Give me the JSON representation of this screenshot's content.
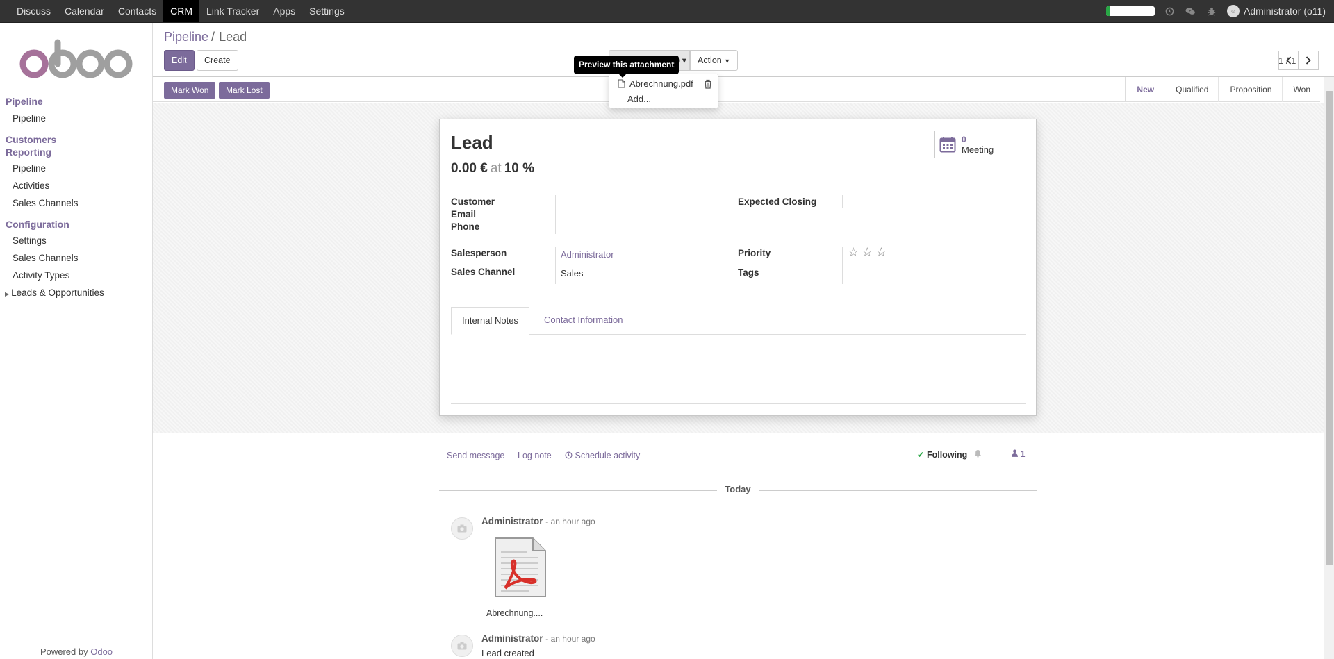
{
  "topbar": {
    "menu": [
      "Discuss",
      "Calendar",
      "Contacts",
      "CRM",
      "Link Tracker",
      "Apps",
      "Settings"
    ],
    "active_menu": "CRM",
    "user_name": "Administrator (o11)",
    "progress_fraction": 0.08
  },
  "sidebar": {
    "logo_text": "odoo",
    "sections": [
      {
        "label": "Pipeline",
        "items": [
          "Pipeline"
        ]
      },
      {
        "label": "Customers",
        "items": []
      },
      {
        "label": "Reporting",
        "items": [
          "Pipeline",
          "Activities",
          "Sales Channels"
        ]
      },
      {
        "label": "Configuration",
        "items": [
          "Settings",
          "Sales Channels",
          "Activity Types"
        ]
      }
    ],
    "collapsed_group": "Leads & Opportunities",
    "powered_by": "Powered by",
    "powered_brand": "Odoo"
  },
  "control_panel": {
    "breadcrumb_parent": "Pipeline",
    "breadcrumb_current": "Lead",
    "edit_label": "Edit",
    "create_label": "Create",
    "attachment_label": "(1) ▾",
    "action_label": "Action",
    "pager_value": "1 / 1"
  },
  "attachments": {
    "tooltip": "Preview this attachment",
    "file_name": "Abrechnung.pdf",
    "add_label": "Add..."
  },
  "statusbar": {
    "mark_won": "Mark Won",
    "mark_lost": "Mark Lost",
    "stages": [
      "New",
      "Qualified",
      "Proposition",
      "Won"
    ],
    "active_stage": "New"
  },
  "form": {
    "title": "Lead",
    "revenue": "0.00 €",
    "at": "at",
    "probability": "10 %",
    "meeting_count": "0",
    "meeting_label": "Meeting",
    "labels": {
      "customer": "Customer",
      "email": "Email",
      "phone": "Phone",
      "salesperson": "Salesperson",
      "sales_channel": "Sales Channel",
      "expected_closing": "Expected Closing",
      "priority": "Priority",
      "tags": "Tags"
    },
    "values": {
      "salesperson": "Administrator",
      "sales_channel": "Sales"
    },
    "priority_stars": 0,
    "tabs": [
      "Internal Notes",
      "Contact Information"
    ],
    "active_tab": "Internal Notes"
  },
  "chatter": {
    "send_message": "Send message",
    "log_note": "Log note",
    "schedule_activity": "Schedule activity",
    "following": "Following",
    "followers_count": "1",
    "date_separator": "Today",
    "messages": [
      {
        "author": "Administrator",
        "time": "- an hour ago",
        "attachment_name": "Abrechnung....",
        "body": ""
      },
      {
        "author": "Administrator",
        "time": "- an hour ago",
        "body": "Lead created"
      }
    ]
  },
  "colors": {
    "brand": "#7c6b9b",
    "navbar": "#333333"
  }
}
